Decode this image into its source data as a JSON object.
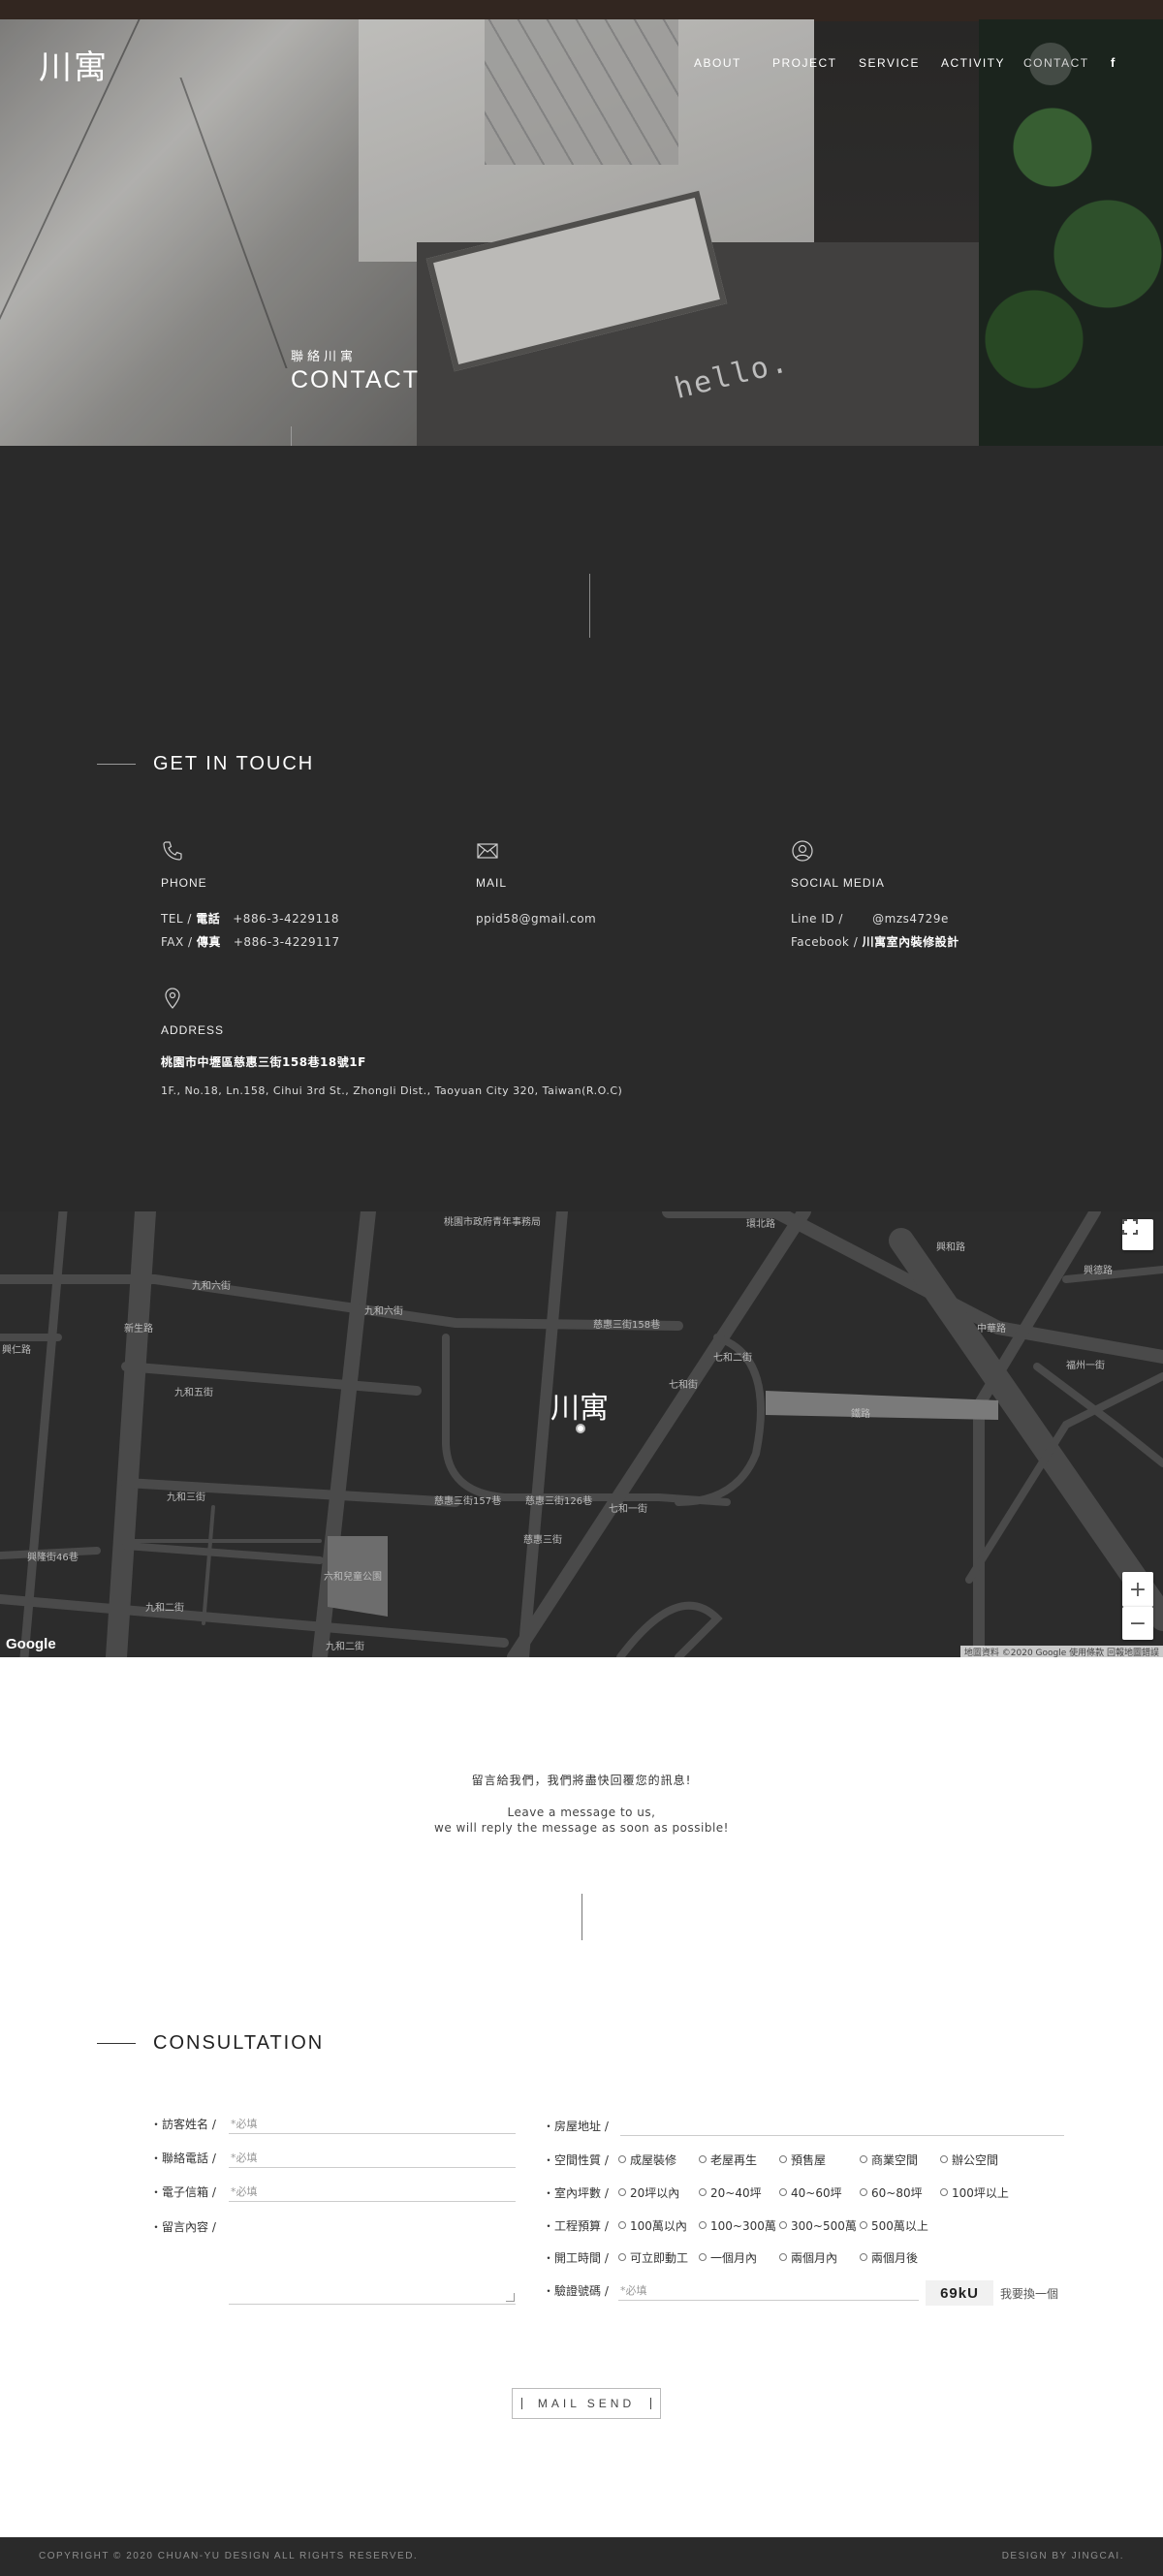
{
  "brand": {
    "logo_text": "川寓"
  },
  "nav": {
    "items": [
      {
        "label": "ABOUT"
      },
      {
        "label": "PROJECT"
      },
      {
        "label": "SERVICE"
      },
      {
        "label": "ACTIVITY"
      },
      {
        "label": "CONTACT",
        "active": true
      }
    ],
    "social_icon": "facebook-icon",
    "social_glyph": "f"
  },
  "hero": {
    "subtitle": "聯絡川寓",
    "title": "CONTACT",
    "photo_text": "hello."
  },
  "get_in_touch": {
    "heading": "GET IN TOUCH",
    "phone": {
      "icon": "phone-icon",
      "label": "PHONE",
      "tel_prefix": "TEL / ",
      "tel_zh": "電話",
      "tel_value": "+886-3-4229118",
      "fax_prefix": "FAX / ",
      "fax_zh": "傳真",
      "fax_value": "+886-3-4229117"
    },
    "mail": {
      "icon": "mail-icon",
      "label": "MAIL",
      "value": "ppid58@gmail.com"
    },
    "social": {
      "icon": "user-icon",
      "label": "SOCIAL MEDIA",
      "line_prefix": "Line ID /",
      "line_value": "@mzs4729e",
      "fb_prefix": "Facebook / ",
      "fb_value": "川寓室內裝修設計"
    },
    "address": {
      "icon": "location-pin-icon",
      "label": "ADDRESS",
      "zh": "桃園市中壢區慈惠三街158巷18號1F",
      "en": "1F., No.18, Ln.158, Cihui 3rd St., Zhongli Dist., Taoyuan City 320, Taiwan(R.O.C)"
    }
  },
  "map": {
    "marker_text": "川寓",
    "google_label": "Google",
    "credit": "地圖資料 ©2020 Google  使用條款  回報地圖錯誤",
    "zoom_in": "+",
    "zoom_out": "−",
    "fullscreen_icon": "fullscreen-icon",
    "labels": [
      "桃園市政府青年事務局",
      "九和六街",
      "九和六街",
      "慈惠三街158巷",
      "九和五街",
      "九和三街",
      "九和二街",
      "慈惠三街157巷",
      "慈惠三街126巷",
      "慈惠三街",
      "七和一街",
      "七和二街",
      "七和街",
      "環北路",
      "興和路",
      "新生路",
      "中華路",
      "福州一街",
      "六和兒童公園",
      "鐵路",
      "興仁路",
      "興隆街46巷",
      "九和二街",
      "興德路"
    ]
  },
  "message": {
    "zh": "留言給我們，我們將盡快回覆您的訊息!",
    "en_line1": "Leave a message to us,",
    "en_line2": "we will reply the message as soon as possible!"
  },
  "consultation": {
    "heading": "CONSULTATION",
    "left_fields": [
      {
        "label": "・訪客姓名 /",
        "placeholder": "*必填"
      },
      {
        "label": "・聯絡電話 /",
        "placeholder": "*必填"
      },
      {
        "label": "・電子信箱 /",
        "placeholder": "*必填"
      },
      {
        "label": "・留言內容 /"
      }
    ],
    "address_label": "・房屋地址 /",
    "radio_groups": [
      {
        "label": "・空間性質 /",
        "options": [
          "成屋裝修",
          "老屋再生",
          "預售屋",
          "商業空間",
          "辦公空間"
        ]
      },
      {
        "label": "・室內坪數 /",
        "options": [
          "20坪以內",
          "20~40坪",
          "40~60坪",
          "60~80坪",
          "100坪以上"
        ]
      },
      {
        "label": "・工程預算 /",
        "options": [
          "100萬以內",
          "100~300萬",
          "300~500萬",
          "500萬以上"
        ]
      },
      {
        "label": "・開工時間 /",
        "options": [
          "可立即動工",
          "一個月內",
          "兩個月內",
          "兩個月後"
        ]
      }
    ],
    "captcha_label": "・驗證號碼 /",
    "captcha_placeholder": "*必填",
    "captcha_code": "69kU",
    "captcha_refresh": "我要換一個",
    "submit": "MAIL SEND"
  },
  "footer": {
    "copyright": "COPYRIGHT © 2020 CHUAN-YU DESIGN ALL RIGHTS RESERVED.",
    "designer": "DESIGN BY JINGCAI."
  }
}
